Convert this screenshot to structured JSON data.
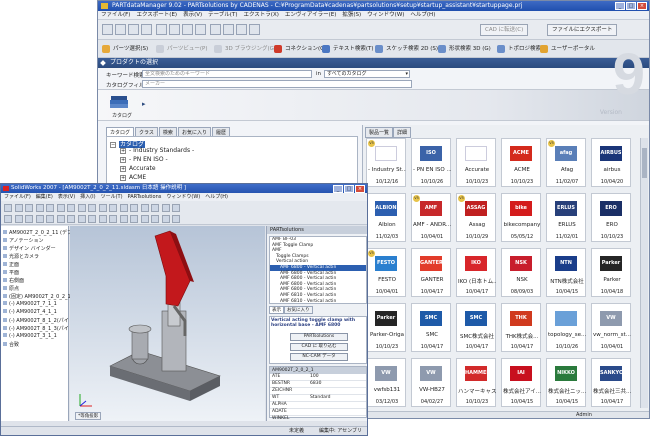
{
  "main": {
    "title": "PARTdataManager 9.02 - PARTsolutions by CADENAS - C:¥ProgramData¥cadenas¥partsolutions¥setup¥startup_assistant¥startuppage.prj",
    "menu": [
      "ファイル(F)",
      "エクスポート(E)",
      "表示(V)",
      "テーブル(T)",
      "エクストラ(X)",
      "エンヴィアイラー(E)",
      "拡張(S)",
      "ウィンドウ(W)",
      "ヘルプ(H)"
    ],
    "cad_label": "CAD に転送(C)",
    "explorer_label": "ファイルにエクスポート",
    "toolbar2": [
      "パーツ選択(S)",
      "パーツビュー(P)",
      "3D ブラウジング(G)",
      "コネクション(C)",
      "テキスト検索(T)",
      "スケッチ検索 2D (S)",
      "形状検索 3D (G)",
      "トポロジ検索",
      "ユーザーポータル"
    ],
    "section_title": "プロダクトの選択",
    "keyword_label": "キーワード検索",
    "keyword_placeholder": "全文検索のためのキーワード",
    "in_label": "in",
    "catalog_scope": "すべてのカタログ",
    "catalog_filter_label": "カタログフィルタ",
    "filter_placeholder": "メーカー",
    "catalog_icon_label": "カタログ",
    "version_word": "Version",
    "version_number": "9",
    "left_tabs": [
      "カタログ",
      "クラス",
      "検索",
      "お気に入り",
      "履歴"
    ],
    "tree": [
      {
        "label": "カタログ",
        "sign": "−"
      },
      {
        "label": "- Industry Standards -",
        "sign": "+"
      },
      {
        "label": "- PN EN ISO -",
        "sign": "+"
      },
      {
        "label": "Accurate",
        "sign": "+"
      },
      {
        "label": "ACME",
        "sign": "+"
      }
    ],
    "right_tabs": [
      "製品一覧",
      "詳細"
    ],
    "tiles": [
      {
        "name": "- Industry St...",
        "date": "10/12/16",
        "logo": "",
        "color": "#ffffff",
        "v5": true
      },
      {
        "name": "- PN EN ISO ...",
        "date": "10/10/26",
        "logo": "ISO",
        "color": "#3b63a8",
        "v5": false
      },
      {
        "name": "Accurate",
        "date": "10/10/23",
        "logo": "",
        "color": "#ffffff",
        "v5": false
      },
      {
        "name": "ACME",
        "date": "10/10/23",
        "logo": "ACME",
        "color": "#d42a1c",
        "v5": false
      },
      {
        "name": "Afag",
        "date": "11/02/07",
        "logo": "afag",
        "color": "#5a7fb8",
        "v5": true
      },
      {
        "name": "airbus",
        "date": "10/04/20",
        "logo": "AIRBUS",
        "color": "#1a3578",
        "v5": false
      },
      {
        "name": "Albion",
        "date": "11/02/03",
        "logo": "ALBION",
        "color": "#2c5fb0",
        "v5": false
      },
      {
        "name": "AMF - ANDR...",
        "date": "10/04/01",
        "logo": "AMF",
        "color": "#c7282a",
        "v5": true
      },
      {
        "name": "Assag",
        "date": "10/10/29",
        "logo": "ASSAG",
        "color": "#c02020",
        "v5": true
      },
      {
        "name": "bikecompany",
        "date": "05/05/12",
        "logo": "bike",
        "color": "#d41c1c",
        "v5": false
      },
      {
        "name": "ERLUS",
        "date": "11/02/01",
        "logo": "ERLUS",
        "color": "#28407a",
        "v5": false
      },
      {
        "name": "ERO",
        "date": "10/10/23",
        "logo": "ERO",
        "color": "#1a2f66",
        "v5": false
      },
      {
        "name": "FESTO",
        "date": "10/04/01",
        "logo": "FESTO",
        "color": "#2a7fcf",
        "v5": true
      },
      {
        "name": "GANTER",
        "date": "10/04/17",
        "logo": "GANTER",
        "color": "#e23b2a",
        "v5": false
      },
      {
        "name": "IKO (日本トム...",
        "date": "10/04/17",
        "logo": "IKO",
        "color": "#d8262a",
        "v5": false
      },
      {
        "name": "NSK",
        "date": "08/09/03",
        "logo": "NSK",
        "color": "#c81e2c",
        "v5": false
      },
      {
        "name": "NTN株式会社",
        "date": "10/04/15",
        "logo": "NTN",
        "color": "#1a3d8a",
        "v5": false
      },
      {
        "name": "Parker",
        "date": "10/04/18",
        "logo": "Parker",
        "color": "#252525",
        "v5": false
      },
      {
        "name": "Parker-Origa",
        "date": "10/10/23",
        "logo": "Parker",
        "color": "#252525",
        "v5": false
      },
      {
        "name": "SMC",
        "date": "10/04/17",
        "logo": "SMC",
        "color": "#1e5aa8",
        "v5": false
      },
      {
        "name": "SMC株式会社",
        "date": "10/04/17",
        "logo": "SMC",
        "color": "#1e5aa8",
        "v5": false
      },
      {
        "name": "THK株式会...",
        "date": "10/04/17",
        "logo": "THK",
        "color": "#d03a1e",
        "v5": false
      },
      {
        "name": "topology_se...",
        "date": "10/10/26",
        "logo": "",
        "color": "#6aa0d8",
        "v5": false
      },
      {
        "name": "vw_norm_st...",
        "date": "10/04/01",
        "logo": "VW",
        "color": "#8e9aae",
        "v5": false
      },
      {
        "name": "vwfsb131",
        "date": "03/12/03",
        "logo": "VW",
        "color": "#8e9aae",
        "v5": false
      },
      {
        "name": "VW-HB27",
        "date": "04/02/27",
        "logo": "VW",
        "color": "#8e9aae",
        "v5": false
      },
      {
        "name": "ハンマーキャス...",
        "date": "10/10/23",
        "logo": "HAMMER",
        "color": "#d22a2a",
        "v5": false
      },
      {
        "name": "株式会社アイ...",
        "date": "10/04/15",
        "logo": "IAI",
        "color": "#c8101e",
        "v5": false
      },
      {
        "name": "株式会社ニッ...",
        "date": "10/04/15",
        "logo": "NIKKO",
        "color": "#2a7a3c",
        "v5": false
      },
      {
        "name": "株式会社三共...",
        "date": "10/04/17",
        "logo": "SANKYO",
        "color": "#2a4a8a",
        "v5": false
      }
    ],
    "status_user": "Admin"
  },
  "solidworks": {
    "title": "SolidWorks 2007 - [AM9002T_2_0_2_11.sldasm 日本語 操作説明 ]",
    "menu": [
      "ファイル(F)",
      "編集(E)",
      "表示(V)",
      "挿入(I)",
      "ツール(T)",
      "PARTsolutions",
      "ウィンドウ(W)",
      "ヘルプ(H)"
    ],
    "tree": [
      "AM9002T_2_0_2_11 (デフォルト表示",
      "アノテーション",
      "デザイン バインダー",
      "光源とカメラ",
      "正面",
      "平面",
      "右側面",
      "原点",
      "(固定) AM9002T_2_0_2_1",
      "(-) AM9002T_7_1_1",
      "(-) AM9002T_4_1_1",
      "(-) AM9002T_8_1_2(パイ",
      "(-) AM9002T_8_1_3(パイ",
      "(-) AM9002T_3_1_1",
      "合致"
    ],
    "panel_title": "PARTsolutions",
    "panel_items": [
      "AMF BF-03",
      "AMF Toggle Clamp",
      "AMF",
      "Toggle Clamps",
      "Vertical action",
      "AMF 6800 - Vertical actin",
      "AMF 6800 - Vertical actin",
      "AMF 6800 - Vertical actin",
      "AMF 6800 - Vertical actin",
      "AMF 6800 - Vertical actin",
      "AMF 6810 - Vertical actin",
      "AMF 6810 - Vertical actin"
    ],
    "panel_tabs": [
      "表示",
      "お気に入り"
    ],
    "desc": "Vertical acting toggle clamp with horizontal base - AMF 6800",
    "btn_cad": "PARTsolutions",
    "btn_cad2": "CAD に 取り込む",
    "btn_more": "NC-CAM データ",
    "param_header": "AM9002T_2_0_2_1",
    "params": [
      [
        "ATE",
        "100"
      ],
      [
        "BESTNR",
        "6830"
      ],
      [
        "ZEICHNR",
        ""
      ],
      [
        "WT",
        "Standard"
      ],
      [
        "ALPHA",
        ""
      ],
      [
        "ADATE",
        ""
      ],
      [
        "WINKEL",
        ""
      ]
    ],
    "status_left": "未定義",
    "status_right": "編集中: アセンブリ",
    "view_label": "*等角投影"
  }
}
